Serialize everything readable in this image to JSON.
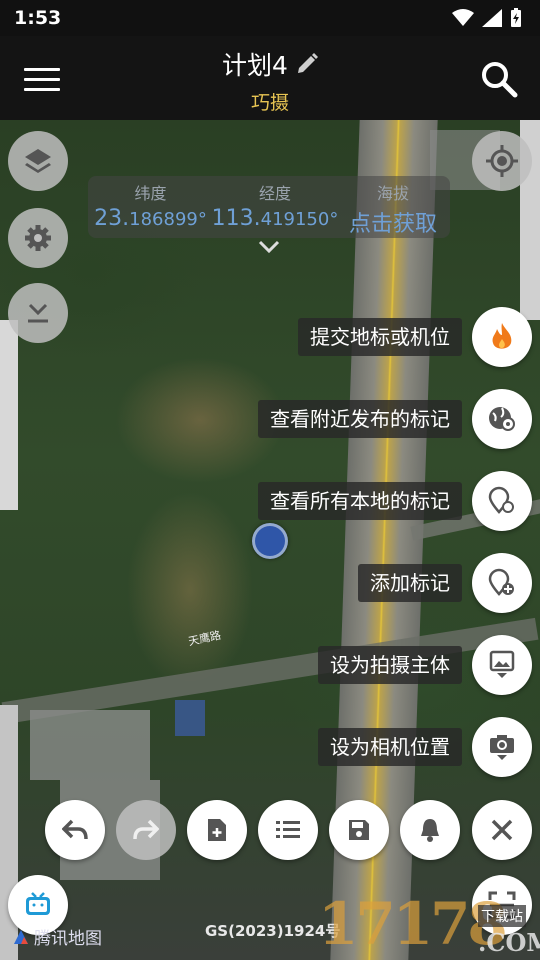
{
  "status": {
    "time": "1:53"
  },
  "header": {
    "title": "计划4",
    "subtitle": "巧摄"
  },
  "coords": {
    "lat_label": "纬度",
    "lat_big": "23.",
    "lat_small": "186899°",
    "lon_label": "经度",
    "lon_big": "113.",
    "lon_small": "419150°",
    "alt_label": "海拔",
    "alt_value": "点击获取"
  },
  "fab_menu": [
    {
      "label": "提交地标或机位",
      "icon": "fire-icon"
    },
    {
      "label": "查看附近发布的标记",
      "icon": "globe-pin-icon"
    },
    {
      "label": "查看所有本地的标记",
      "icon": "pins-icon"
    },
    {
      "label": "添加标记",
      "icon": "add-pin-icon"
    },
    {
      "label": "设为拍摄主体",
      "icon": "subject-icon"
    },
    {
      "label": "设为相机位置",
      "icon": "camera-pin-icon"
    }
  ],
  "map": {
    "road_label": "天鹰路",
    "copyright": "GS(2023)1924号",
    "provider": "腾讯地图"
  },
  "watermark": {
    "number": "17178",
    "domain": ".COM",
    "tag": "下载站"
  },
  "colors": {
    "accent": "#e8c553",
    "coord_blue": "#6fa0d6",
    "fire": "#f07a1a"
  }
}
